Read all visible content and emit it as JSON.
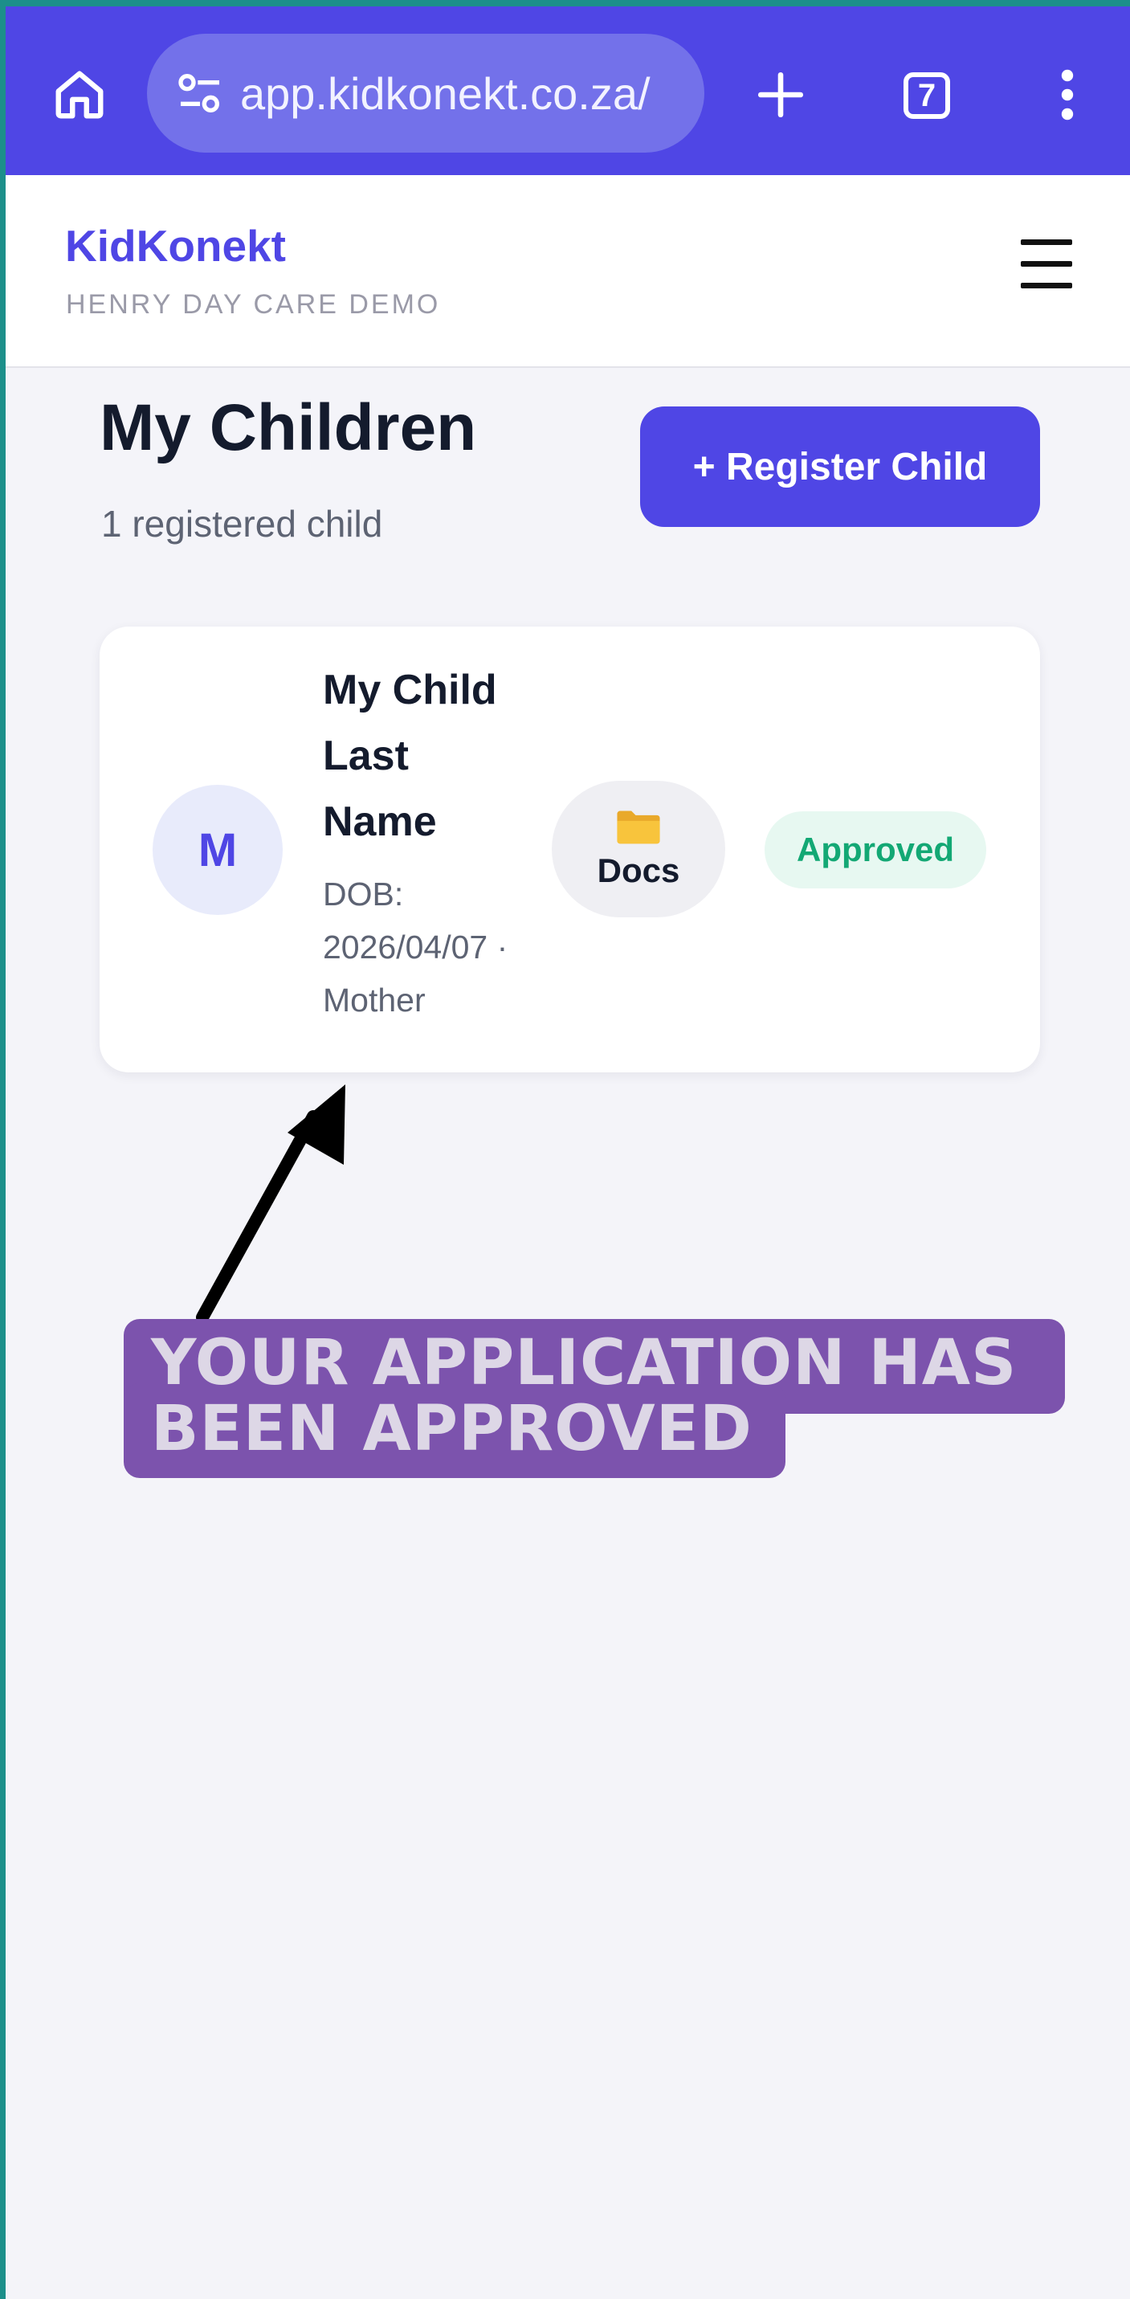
{
  "browser": {
    "url": "app.kidkonekt.co.za/",
    "tab_count": "7",
    "icons": [
      "home-icon",
      "site-settings-icon",
      "new-tab-icon",
      "tab-switcher-icon",
      "more-menu-icon"
    ],
    "bar_color": "#4f46e5"
  },
  "header": {
    "brand": "KidKonekt",
    "tenant": "HENRY DAY CARE DEMO",
    "menu_icon": "hamburger-menu-icon"
  },
  "page": {
    "title": "My Children",
    "subtitle": "1 registered child",
    "register_button": "+ Register Child"
  },
  "children": [
    {
      "initial": "M",
      "name": "My Child Last Name",
      "dob": "DOB: 2026/04/07",
      "relation": "· Mother",
      "docs_icon": "folder-icon",
      "docs_label": "Docs",
      "status": "Approved",
      "status_color": "#13a874"
    }
  ],
  "annotation": {
    "text": "YOUR APPLICATION HAS BEEN APPROVED",
    "color": "#7c53ad"
  }
}
